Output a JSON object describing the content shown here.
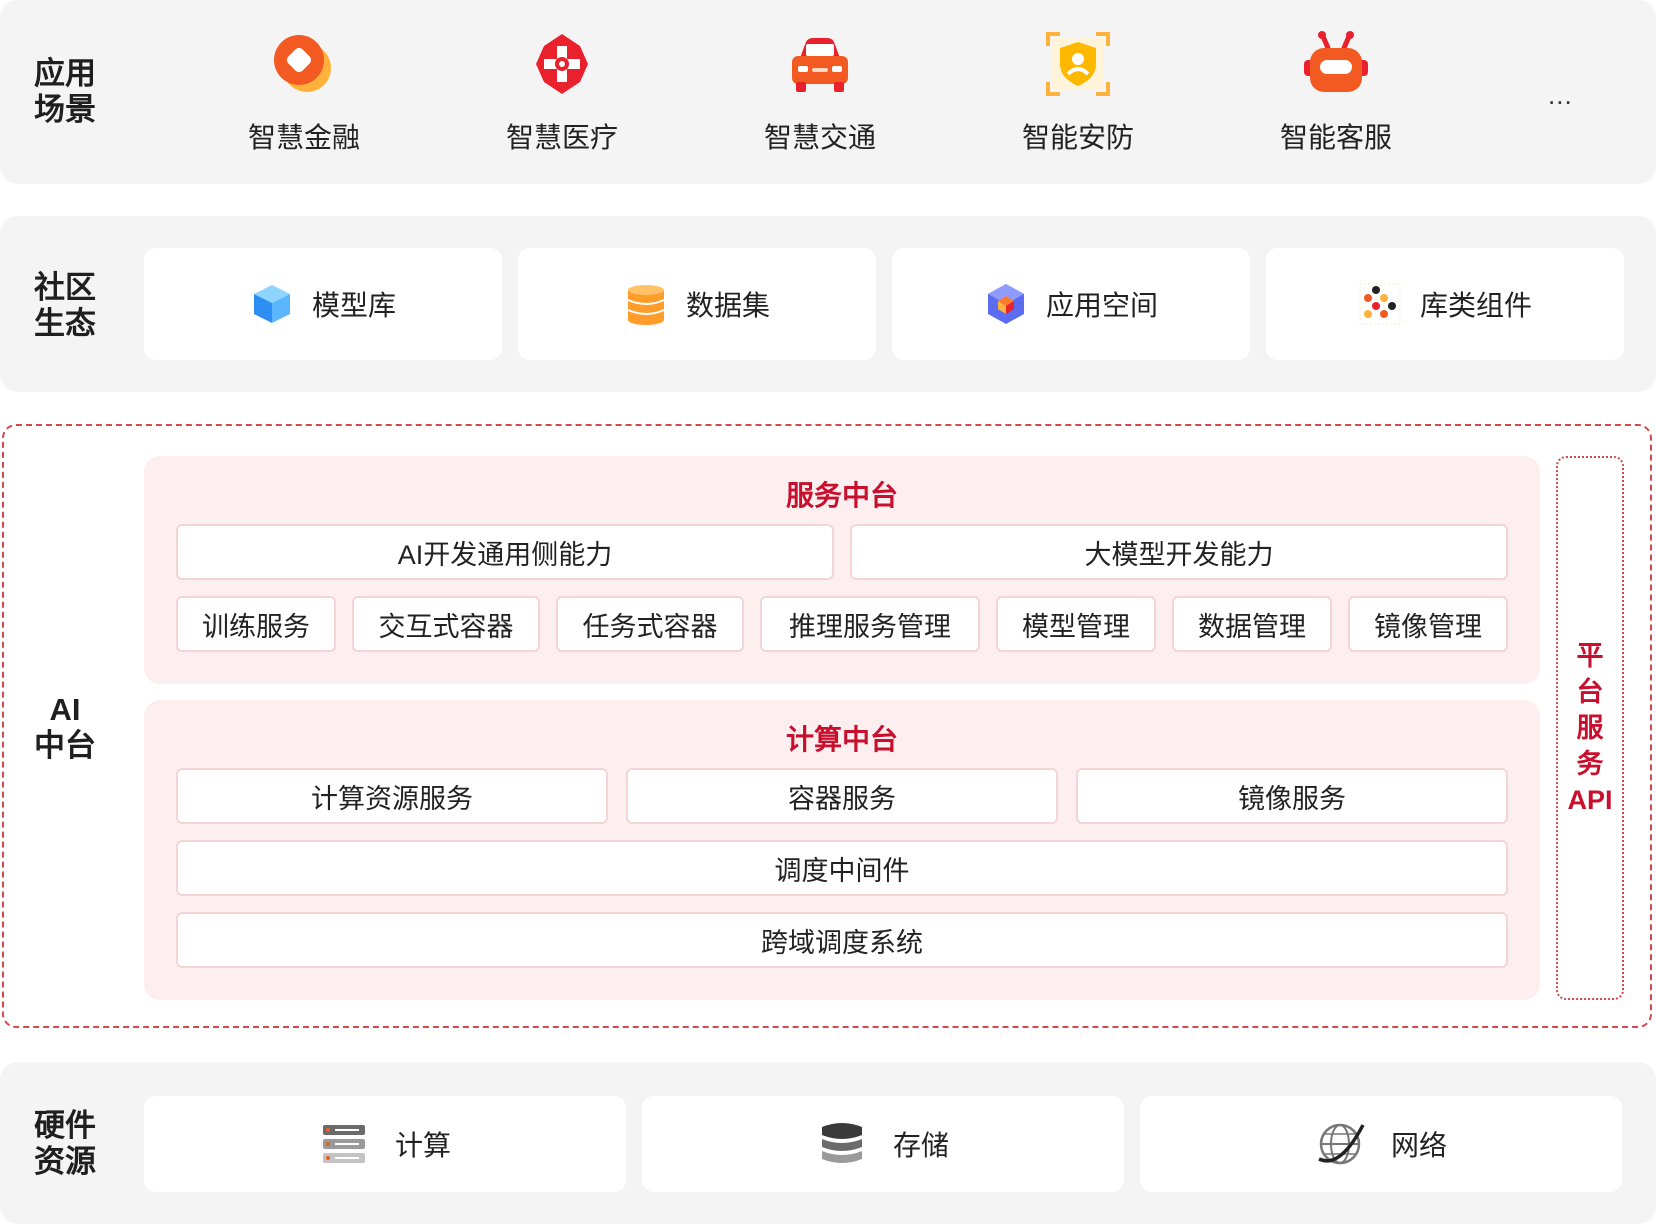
{
  "scenarios": {
    "label": "应用\n场景",
    "items": [
      {
        "label": "智慧金融",
        "icon": "finance-icon"
      },
      {
        "label": "智慧医疗",
        "icon": "medical-icon"
      },
      {
        "label": "智慧交通",
        "icon": "car-icon"
      },
      {
        "label": "智能安防",
        "icon": "security-shield-icon"
      },
      {
        "label": "智能客服",
        "icon": "robot-icon"
      }
    ],
    "more": "..."
  },
  "community": {
    "label": "社区\n生态",
    "items": [
      {
        "label": "模型库",
        "icon": "cube-icon"
      },
      {
        "label": "数据集",
        "icon": "database-icon"
      },
      {
        "label": "应用空间",
        "icon": "app-space-icon"
      },
      {
        "label": "库类组件",
        "icon": "components-icon"
      }
    ]
  },
  "ai_platform": {
    "label": "AI\n中台",
    "service": {
      "title": "服务中台",
      "capabilities": [
        "AI开发通用侧能力",
        "大模型开发能力"
      ],
      "services": [
        "训练服务",
        "交互式容器",
        "任务式容器",
        "推理服务管理",
        "模型管理",
        "数据管理",
        "镜像管理"
      ]
    },
    "compute": {
      "title": "计算中台",
      "services": [
        "计算资源服务",
        "容器服务",
        "镜像服务"
      ],
      "middleware": "调度中间件",
      "cross_domain": "跨域调度系统"
    },
    "api": "平\n台\n服\n务\nAPI"
  },
  "hardware": {
    "label": "硬件\n资源",
    "items": [
      {
        "label": "计算",
        "icon": "server-icon"
      },
      {
        "label": "存储",
        "icon": "storage-icon"
      },
      {
        "label": "网络",
        "icon": "globe-icon"
      }
    ]
  },
  "colors": {
    "accent_red": "#c8102e",
    "band_gray": "#f4f4f5",
    "panel_pink": "#fdeff0",
    "icon_orange": "#f35a21"
  }
}
